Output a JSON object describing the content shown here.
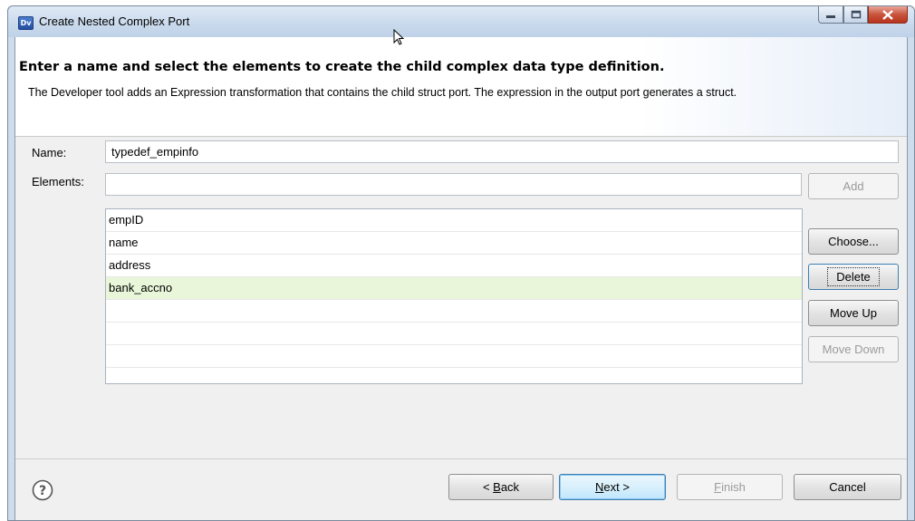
{
  "window": {
    "title": "Create Nested Complex Port",
    "app_icon_text": "Dv"
  },
  "header": {
    "title": "Enter a name and select the elements to create the child complex data type definition.",
    "description": "The Developer tool adds an Expression transformation that contains the child struct port. The expression in the output port generates a struct."
  },
  "form": {
    "name_label": "Name:",
    "name_value": "typedef_empinfo",
    "elements_label": "Elements:",
    "elements_value": ""
  },
  "elements_list": {
    "items": [
      "empID",
      "name",
      "address",
      "bank_accno",
      "",
      "",
      ""
    ],
    "selected_index": 3
  },
  "side_buttons": {
    "add": "Add",
    "choose": "Choose...",
    "delete": "Delete",
    "move_up": "Move Up",
    "move_down": "Move Down"
  },
  "footer": {
    "back_prefix": "< ",
    "back_mnemonic": "B",
    "back_rest": "ack",
    "next_mnemonic": "N",
    "next_rest": "ext >",
    "finish_mnemonic": "F",
    "finish_rest": "inish",
    "cancel": "Cancel"
  },
  "colors": {
    "selected_row": "#e9f6d9",
    "title_bar": "#c9d9ec",
    "close_button": "#c9553d"
  },
  "icons": [
    "app-icon",
    "mouse-cursor-icon",
    "minimize-icon",
    "maximize-icon",
    "close-icon",
    "help-icon"
  ]
}
